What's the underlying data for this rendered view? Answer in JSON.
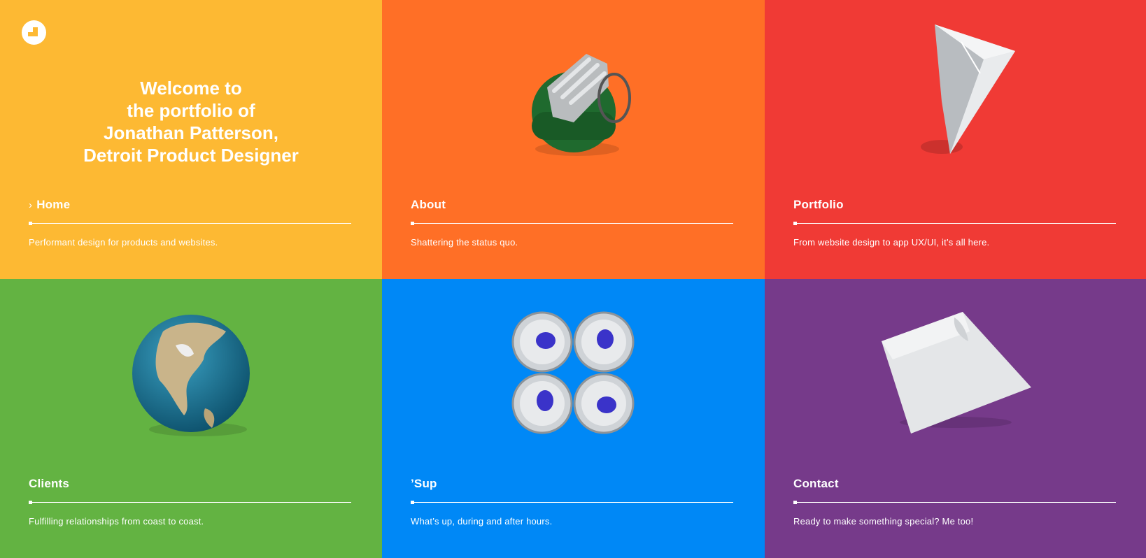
{
  "hero": {
    "lines": [
      "Welcome to",
      "the portfolio of",
      "Jonathan Patterson,",
      "Detroit Product Designer"
    ]
  },
  "tiles": [
    {
      "title": "Home",
      "active_marker": "›",
      "description": "Performant design for products and websites.",
      "color": "#FDB933",
      "icon": "logo-icon"
    },
    {
      "title": "About",
      "description": "Shattering the status quo.",
      "color": "#FF6F26",
      "icon": "grenade-icon"
    },
    {
      "title": "Portfolio",
      "description": "From website design to app UX/UI, it’s all here.",
      "color": "#F03A35",
      "icon": "glass-prism-icon"
    },
    {
      "title": "Clients",
      "description": "Fulfilling relationships from coast to coast.",
      "color": "#63B342",
      "icon": "globe-icon"
    },
    {
      "title": "’Sup",
      "description": "What’s up, during and after hours.",
      "color": "#0088F6",
      "icon": "energy-cans-icon"
    },
    {
      "title": "Contact",
      "description": "Ready to make something special? Me too!",
      "color": "#763A8A",
      "icon": "paper-sheet-icon"
    }
  ]
}
